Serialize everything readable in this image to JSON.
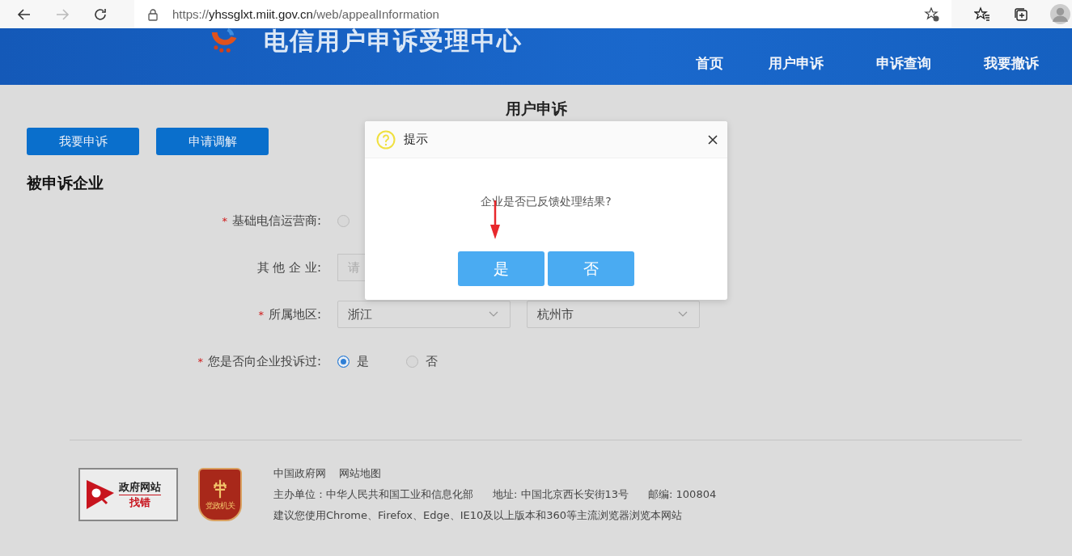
{
  "browser": {
    "url_scheme": "https://",
    "url_host": "yhssglxt.miit.gov.cn",
    "url_path": "/web/appealInformation"
  },
  "header": {
    "site_title": "电信用户申诉受理中心",
    "nav": [
      {
        "label": "首页"
      },
      {
        "label": "用户申诉"
      },
      {
        "label": "申诉查询"
      },
      {
        "label": "我要撤诉"
      }
    ]
  },
  "page": {
    "title": "用户申诉",
    "actions": [
      {
        "label": "我要申诉"
      },
      {
        "label": "申请调解"
      }
    ],
    "section_title": "被申诉企业",
    "rows": [
      {
        "kind": "radio",
        "required_mark": "*",
        "label": "基础电信运营商:",
        "options": [
          {
            "selected": false
          }
        ]
      },
      {
        "kind": "input",
        "label": "其 他 企 业:",
        "placeholder": "请"
      },
      {
        "kind": "select",
        "required_mark": "*",
        "label": "所属地区:",
        "selects": [
          {
            "value": "浙江"
          },
          {
            "value": "杭州市"
          }
        ]
      },
      {
        "kind": "radio",
        "required_mark": "*",
        "label": "您是否向企业投诉过:",
        "options": [
          {
            "label": "是",
            "selected": true
          },
          {
            "label": "否",
            "selected": false
          }
        ]
      }
    ]
  },
  "dialog": {
    "title": "提示",
    "message": "企业是否已反馈处理结果?",
    "buttons": [
      {
        "label": "是"
      },
      {
        "label": "否"
      }
    ]
  },
  "footer": {
    "badge_top": "政府网站",
    "badge_bottom": "找错",
    "emblem": "党政机关",
    "links": [
      {
        "label": "中国政府网"
      },
      {
        "label": "网站地图"
      }
    ],
    "info": [
      "主办单位：中华人民共和国工业和信息化部",
      "地址: 中国北京西长安街13号",
      "邮编: 100804"
    ],
    "note": "建议您使用Chrome、Firefox、Edge、IE10及以上版本和360等主流浏览器浏览本网站"
  }
}
